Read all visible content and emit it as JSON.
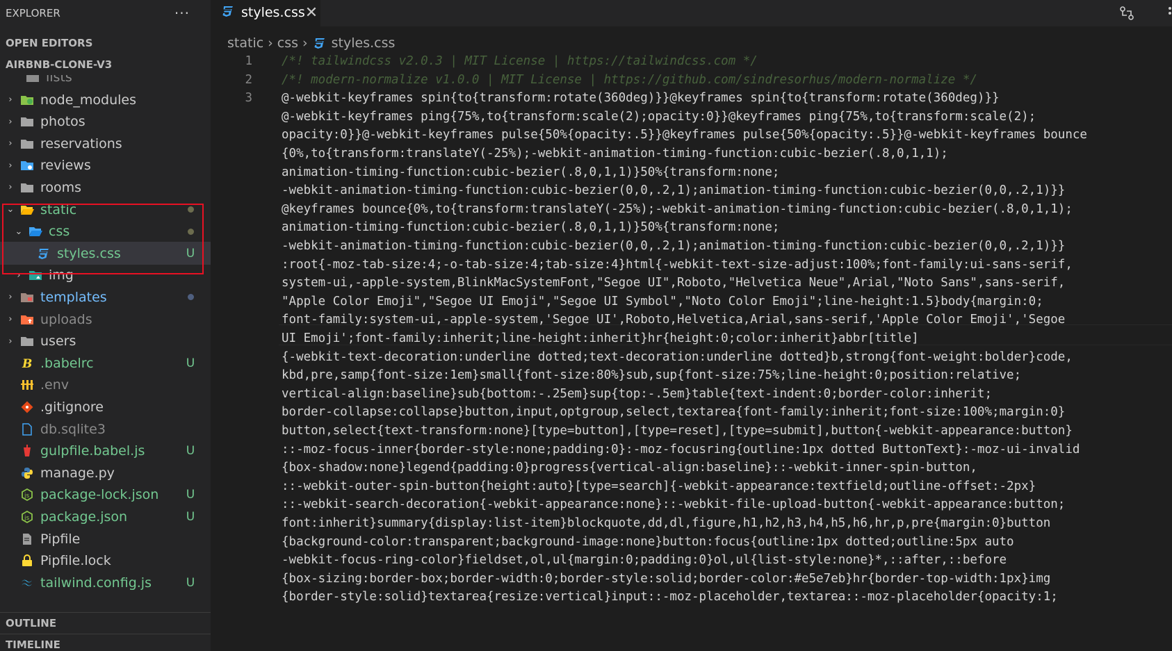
{
  "explorer": {
    "title": "EXPLORER",
    "more_label": "···",
    "open_editors": "OPEN EDITORS",
    "project": "AIRBNB-CLONE-V3",
    "partial_item": "lists",
    "items": [
      {
        "label": "node_modules",
        "badge": "",
        "icon": "folder-node-icon"
      },
      {
        "label": "photos",
        "badge": "",
        "icon": "folder-icon"
      },
      {
        "label": "reservations",
        "badge": "",
        "icon": "folder-icon"
      },
      {
        "label": "reviews",
        "badge": "",
        "icon": "folder-review-icon"
      },
      {
        "label": "rooms",
        "badge": "",
        "icon": "folder-icon"
      },
      {
        "label": "static",
        "badge": "",
        "icon": "folder-open-icon"
      },
      {
        "label": "css",
        "badge": "",
        "icon": "folder-css-icon"
      },
      {
        "label": "styles.css",
        "badge": "U",
        "icon": "css-file-icon"
      },
      {
        "label": "img",
        "badge": "",
        "icon": "folder-images-icon"
      },
      {
        "label": "templates",
        "badge": "",
        "icon": "folder-templates-icon"
      },
      {
        "label": "uploads",
        "badge": "",
        "icon": "folder-uploads-icon"
      },
      {
        "label": "users",
        "badge": "",
        "icon": "folder-icon"
      },
      {
        "label": ".babelrc",
        "badge": "U",
        "icon": "babel-icon"
      },
      {
        "label": ".env",
        "badge": "",
        "icon": "env-icon"
      },
      {
        "label": ".gitignore",
        "badge": "",
        "icon": "git-icon"
      },
      {
        "label": "db.sqlite3",
        "badge": "",
        "icon": "file-icon"
      },
      {
        "label": "gulpfile.babel.js",
        "badge": "U",
        "icon": "gulp-icon"
      },
      {
        "label": "manage.py",
        "badge": "",
        "icon": "python-icon"
      },
      {
        "label": "package-lock.json",
        "badge": "U",
        "icon": "node-icon"
      },
      {
        "label": "package.json",
        "badge": "U",
        "icon": "node-icon"
      },
      {
        "label": "Pipfile",
        "badge": "",
        "icon": "pipfile-icon"
      },
      {
        "label": "Pipfile.lock",
        "badge": "",
        "icon": "lock-icon"
      },
      {
        "label": "tailwind.config.js",
        "badge": "U",
        "icon": "tailwind-icon"
      }
    ],
    "outline": "OUTLINE",
    "timeline": "TIMELINE"
  },
  "editor": {
    "tab_label": "styles.css",
    "close_glyph": "✕",
    "breadcrumb": [
      "static",
      "css",
      "styles.css"
    ],
    "line_numbers": [
      "1",
      "2",
      "3"
    ],
    "lines": [
      "/*! tailwindcss v2.0.3 | MIT License | https://tailwindcss.com */",
      "/*! modern-normalize v1.0.0 | MIT License | https://github.com/sindresorhus/modern-normalize */",
      "@-webkit-keyframes spin{to{transform:rotate(360deg)}}@keyframes spin{to{transform:rotate(360deg)}}",
      "@-webkit-keyframes ping{75%,to{transform:scale(2);opacity:0}}@keyframes ping{75%,to{transform:scale(2);",
      "opacity:0}}@-webkit-keyframes pulse{50%{opacity:.5}}@keyframes pulse{50%{opacity:.5}}@-webkit-keyframes bounce",
      "{0%,to{transform:translateY(-25%);-webkit-animation-timing-function:cubic-bezier(.8,0,1,1);",
      "animation-timing-function:cubic-bezier(.8,0,1,1)}50%{transform:none;",
      "-webkit-animation-timing-function:cubic-bezier(0,0,.2,1);animation-timing-function:cubic-bezier(0,0,.2,1)}}",
      "@keyframes bounce{0%,to{transform:translateY(-25%);-webkit-animation-timing-function:cubic-bezier(.8,0,1,1);",
      "animation-timing-function:cubic-bezier(.8,0,1,1)}50%{transform:none;",
      "-webkit-animation-timing-function:cubic-bezier(0,0,.2,1);animation-timing-function:cubic-bezier(0,0,.2,1)}}",
      ":root{-moz-tab-size:4;-o-tab-size:4;tab-size:4}html{-webkit-text-size-adjust:100%;font-family:ui-sans-serif,",
      "system-ui,-apple-system,BlinkMacSystemFont,\"Segoe UI\",Roboto,\"Helvetica Neue\",Arial,\"Noto Sans\",sans-serif,",
      "\"Apple Color Emoji\",\"Segoe UI Emoji\",\"Segoe UI Symbol\",\"Noto Color Emoji\";line-height:1.5}body{margin:0;",
      "font-family:system-ui,-apple-system,'Segoe UI',Roboto,Helvetica,Arial,sans-serif,'Apple Color Emoji','Segoe",
      "UI Emoji';font-family:inherit;line-height:inherit}hr{height:0;color:inherit}abbr[title]",
      "{-webkit-text-decoration:underline dotted;text-decoration:underline dotted}b,strong{font-weight:bolder}code,",
      "kbd,pre,samp{font-size:1em}small{font-size:80%}sub,sup{font-size:75%;line-height:0;position:relative;",
      "vertical-align:baseline}sub{bottom:-.25em}sup{top:-.5em}table{text-indent:0;border-color:inherit;",
      "border-collapse:collapse}button,input,optgroup,select,textarea{font-family:inherit;font-size:100%;margin:0}",
      "button,select{text-transform:none}[type=button],[type=reset],[type=submit],button{-webkit-appearance:button}",
      "::-moz-focus-inner{border-style:none;padding:0}:-moz-focusring{outline:1px dotted ButtonText}:-moz-ui-invalid",
      "{box-shadow:none}legend{padding:0}progress{vertical-align:baseline}::-webkit-inner-spin-button,",
      "::-webkit-outer-spin-button{height:auto}[type=search]{-webkit-appearance:textfield;outline-offset:-2px}",
      "::-webkit-search-decoration{-webkit-appearance:none}::-webkit-file-upload-button{-webkit-appearance:button;",
      "font:inherit}summary{display:list-item}blockquote,dd,dl,figure,h1,h2,h3,h4,h5,h6,hr,p,pre{margin:0}button",
      "{background-color:transparent;background-image:none}button:focus{outline:1px dotted;outline:5px auto",
      "-webkit-focus-ring-color}fieldset,ol,ul{margin:0;padding:0}ol,ul{list-style:none}*,::after,::before",
      "{box-sizing:border-box;border-width:0;border-style:solid;border-color:#e5e7eb}hr{border-top-width:1px}img",
      "{border-style:solid}textarea{resize:vertical}input::-moz-placeholder,textarea::-moz-placeholder{opacity:1;"
    ]
  }
}
